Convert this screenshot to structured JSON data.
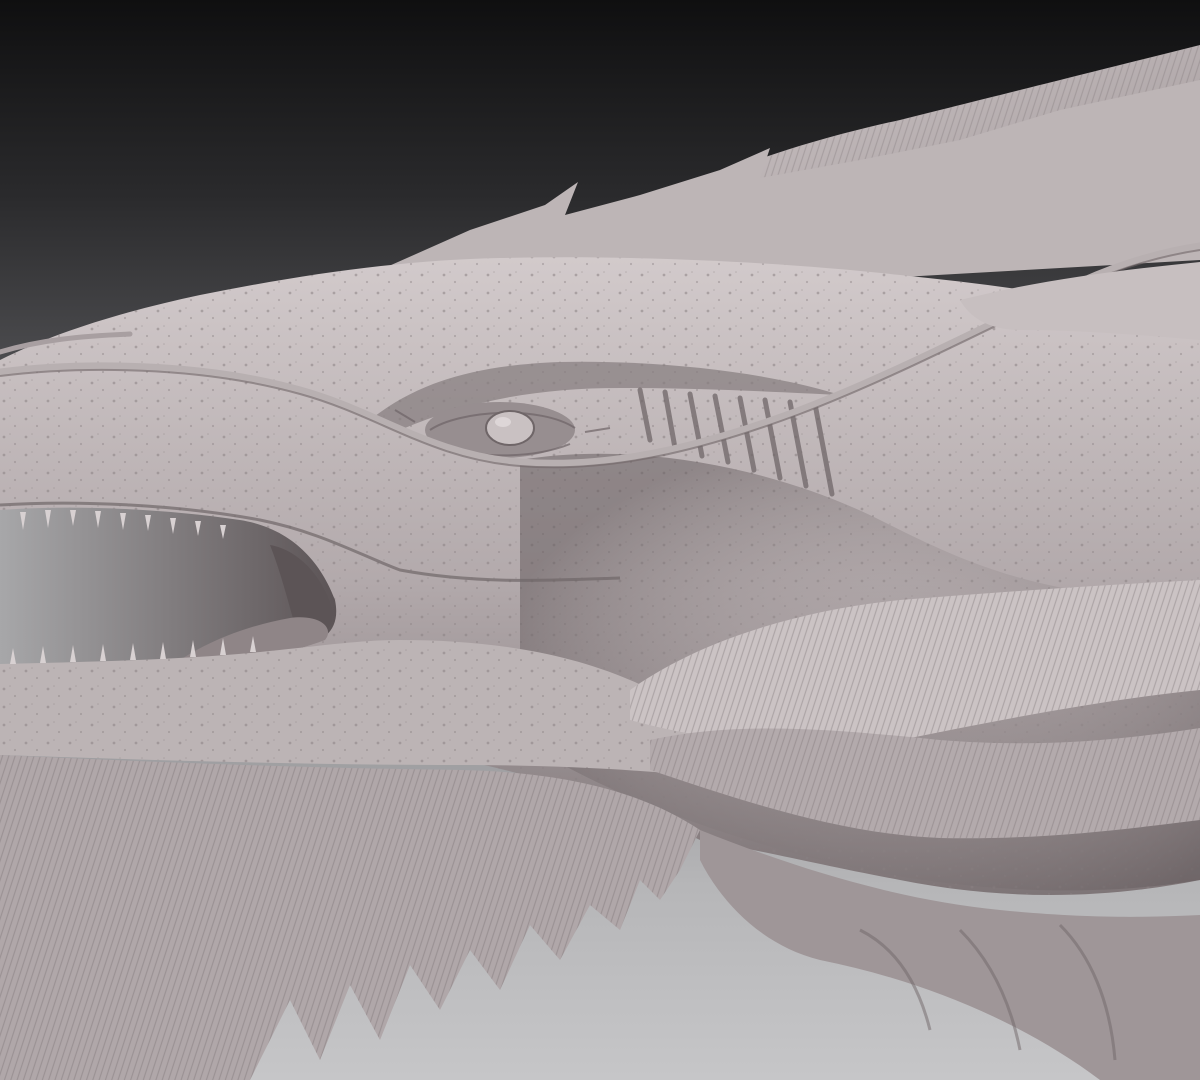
{
  "image": {
    "subject": "dragon-head-sculpt",
    "palette": {
      "background_top": "#0f0f10",
      "background_bottom": "#c6c6c8",
      "skin_light": "#c9c1c2",
      "skin_mid": "#a89fa1",
      "skin_shadow": "#6f6668",
      "mouth_interior": "#5c5456",
      "tongue": "#8f8587"
    }
  }
}
